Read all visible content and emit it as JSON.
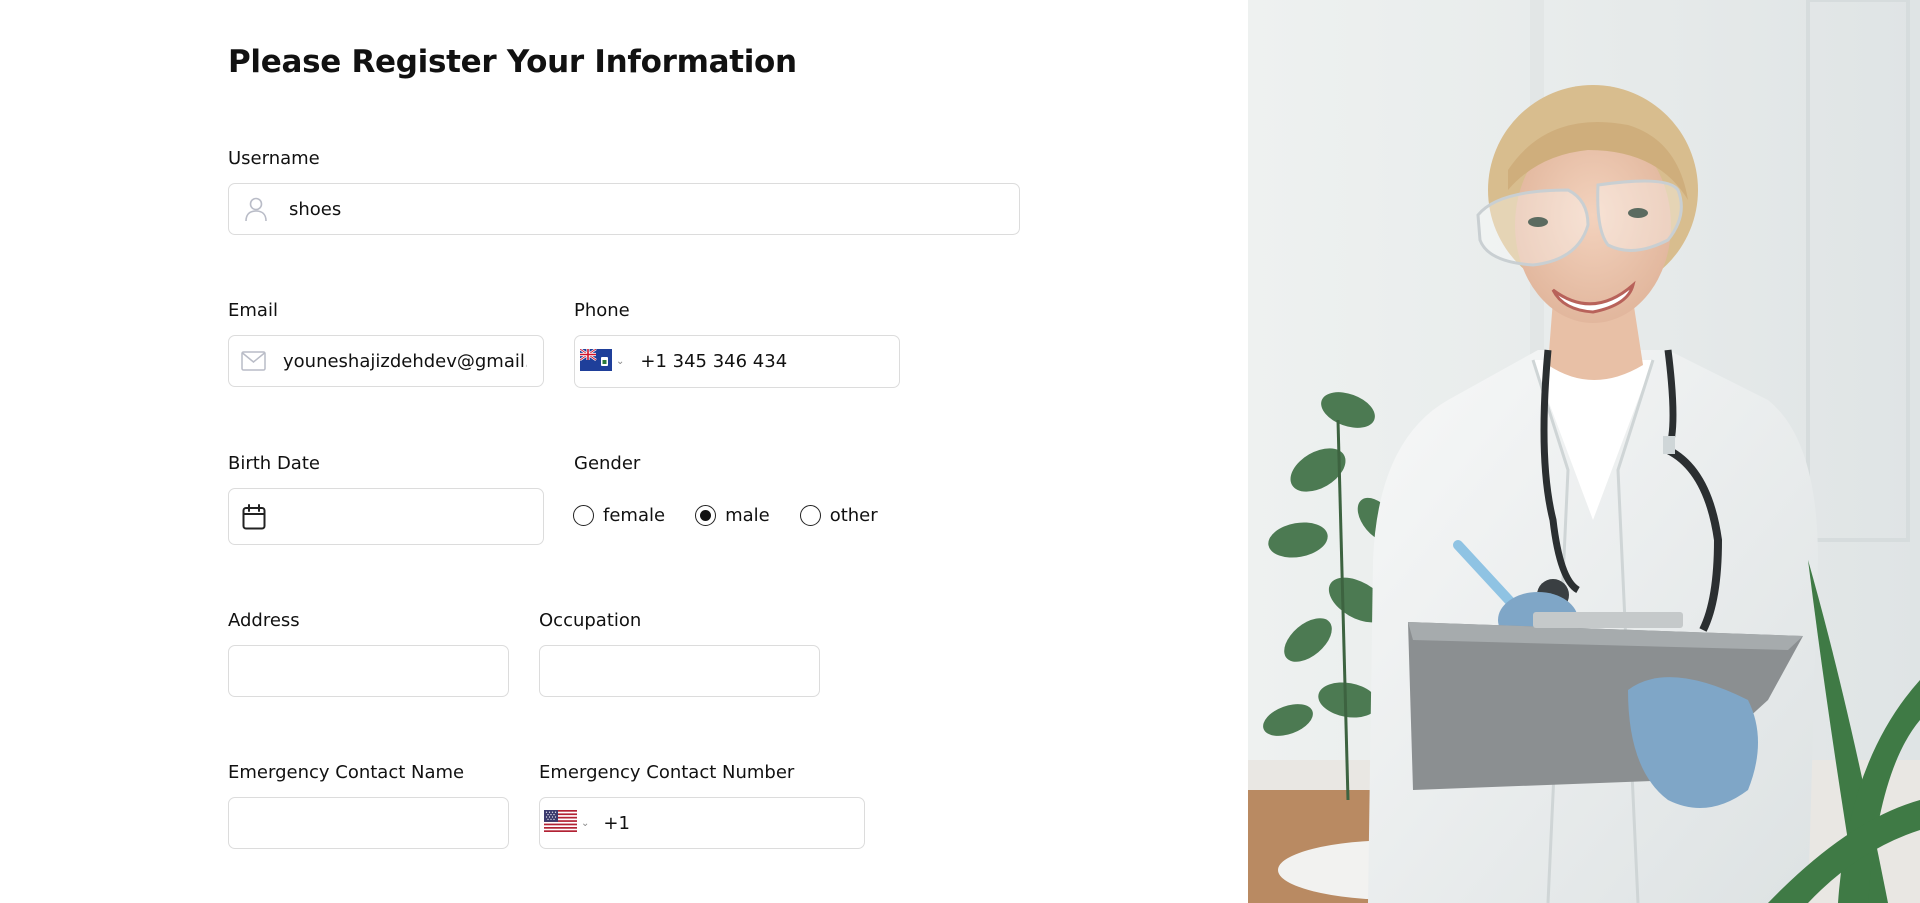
{
  "form": {
    "title": "Please Register Your Information",
    "username": {
      "label": "Username",
      "value": "shoes",
      "icon": "user-icon"
    },
    "email": {
      "label": "Email",
      "value": "youneshajizdehdev@gmail.com",
      "icon": "mail-icon"
    },
    "phone": {
      "label": "Phone",
      "flag": "cayman-islands-flag",
      "value": "+1 345 346 434"
    },
    "birth_date": {
      "label": "Birth Date",
      "icon": "calendar-icon",
      "value": ""
    },
    "gender": {
      "label": "Gender",
      "options": [
        "female",
        "male",
        "other"
      ],
      "selected": "male"
    },
    "address": {
      "label": "Address",
      "value": ""
    },
    "occupation": {
      "label": "Occupation",
      "value": ""
    },
    "emergency_name": {
      "label": "Emergency Contact Name",
      "value": ""
    },
    "emergency_number": {
      "label": "Emergency Contact Number",
      "flag": "us-flag",
      "value": "+1"
    }
  },
  "colors": {
    "field_border": "#dcdcdc",
    "text": "#111111",
    "icon_gray": "#b9bcc7",
    "background": "#ffffff"
  }
}
